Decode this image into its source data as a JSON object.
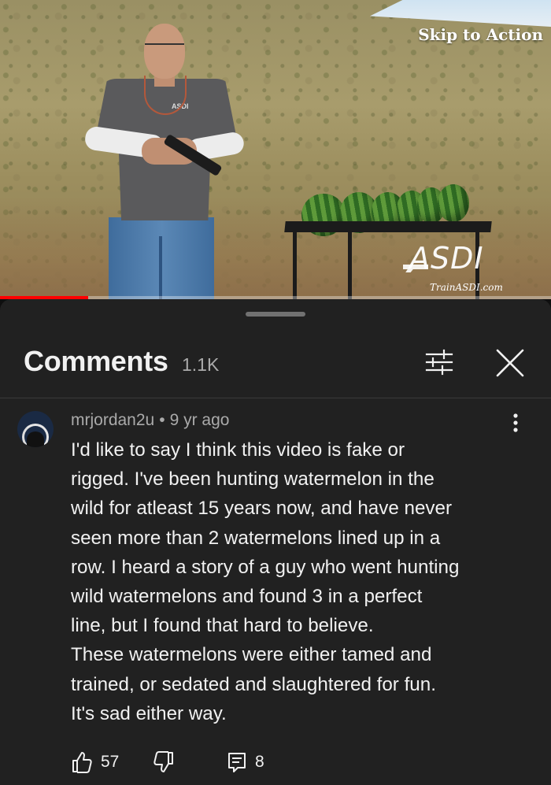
{
  "video": {
    "skip_label": "Skip to Action",
    "watermark_brand": "ASDI",
    "watermark_url": "TrainASDI.com",
    "shirt_logo": "ASDI",
    "progress": 0.16,
    "progress_color": "#ff0000"
  },
  "comments_panel": {
    "title": "Comments",
    "count": "1.1K",
    "filter_icon": "sliders-icon",
    "close_icon": "close-icon"
  },
  "comment": {
    "author": "mrjordan2u",
    "separator": "•",
    "age": "9 yr ago",
    "lines": [
      "I'd like to say I think this video is fake or",
      "rigged. I've been hunting watermelon in the",
      "wild for atleast 15 years now, and have never",
      "seen more than 2 watermelons lined up in a",
      "row. I heard a story of a guy who went hunting",
      "wild watermelons and found 3 in a perfect",
      "line, but I found that hard to believe.",
      "These watermelons were either tamed and",
      "trained, or sedated and slaughtered for fun.",
      "It's sad either way."
    ],
    "likes": "57",
    "replies": "8",
    "like_icon": "thumbs-up-icon",
    "dislike_icon": "thumbs-down-icon",
    "reply_icon": "reply-icon",
    "more_icon": "more-vertical-icon"
  },
  "colors": {
    "sheet_bg": "#212121",
    "page_bg": "#0f0f0f",
    "text_primary": "#f1f1f1",
    "text_secondary": "#aaaaaa"
  }
}
